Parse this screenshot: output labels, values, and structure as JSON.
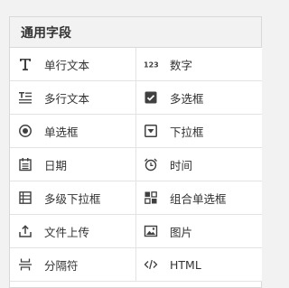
{
  "panel": {
    "title": "通用字段",
    "items": [
      {
        "label": "单行文本",
        "icon": "text-t-icon"
      },
      {
        "label": "数字",
        "icon": "number-123-icon"
      },
      {
        "label": "多行文本",
        "icon": "multiline-text-icon"
      },
      {
        "label": "多选框",
        "icon": "checkbox-icon"
      },
      {
        "label": "单选框",
        "icon": "radio-icon"
      },
      {
        "label": "下拉框",
        "icon": "dropdown-icon"
      },
      {
        "label": "日期",
        "icon": "calendar-icon"
      },
      {
        "label": "时间",
        "icon": "clock-icon"
      },
      {
        "label": "多级下拉框",
        "icon": "cascade-select-icon"
      },
      {
        "label": "组合单选框",
        "icon": "combo-radio-icon"
      },
      {
        "label": "文件上传",
        "icon": "upload-icon"
      },
      {
        "label": "图片",
        "icon": "image-icon"
      },
      {
        "label": "分隔符",
        "icon": "divider-icon"
      },
      {
        "label": "HTML",
        "icon": "code-icon"
      }
    ]
  },
  "colors": {
    "background": "#f2f2f2",
    "header": "#f2f2f2",
    "border": "#d9d9d9",
    "text": "#333333",
    "icon": "#404040"
  }
}
